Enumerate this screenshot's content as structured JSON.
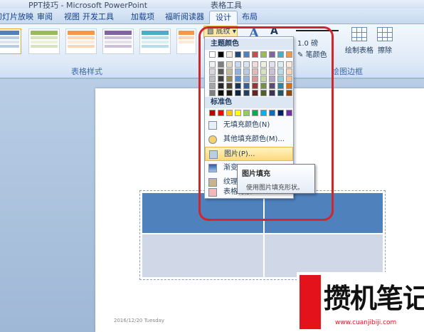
{
  "window": {
    "title": "PPT技巧 - Microsoft PowerPoint",
    "context_tab_group": "表格工具"
  },
  "ribbon_tabs": [
    {
      "label": "幻灯片放映"
    },
    {
      "label": "审阅"
    },
    {
      "label": "视图"
    },
    {
      "label": "开发工具"
    },
    {
      "label": "加载项"
    },
    {
      "label": "福昕阅读器"
    },
    {
      "label": "设计"
    },
    {
      "label": "布局"
    }
  ],
  "active_tab": "设计",
  "ribbon": {
    "table_styles_group": "表格样式",
    "shading_button": "底纹",
    "pen_weight": "1.0 磅",
    "pen_color": "笔颜色",
    "draw_table": "绘制表格",
    "eraser": "擦除",
    "draw_borders_group": "绘图边框"
  },
  "shading_menu": {
    "theme_colors_header": "主题颜色",
    "standard_colors_header": "标准色",
    "theme_top_row": [
      "#ffffff",
      "#000000",
      "#eeece1",
      "#1f497d",
      "#4f81bd",
      "#c0504d",
      "#9bbb59",
      "#8064a2",
      "#4bacc6",
      "#f79646"
    ],
    "theme_tints": [
      [
        "#f2f2f2",
        "#7f7f7f",
        "#ddd9c3",
        "#c6d9f0",
        "#dbe5f1",
        "#f2dcdb",
        "#ebf1dd",
        "#e5e0ec",
        "#dbeef3",
        "#fdeada"
      ],
      [
        "#d8d8d8",
        "#595959",
        "#c4bd97",
        "#8db3e2",
        "#b8cce4",
        "#e5b9b7",
        "#d7e3bc",
        "#ccc1d9",
        "#b7dde8",
        "#fbd5b5"
      ],
      [
        "#bfbfbf",
        "#3f3f3f",
        "#938953",
        "#548dd4",
        "#95b3d7",
        "#d99694",
        "#c3d69b",
        "#b2a2c7",
        "#92cddc",
        "#fac08f"
      ],
      [
        "#a5a5a5",
        "#262626",
        "#494429",
        "#17365d",
        "#366092",
        "#953734",
        "#76923c",
        "#5f497a",
        "#31859b",
        "#e36c09"
      ],
      [
        "#7f7f7f",
        "#0c0c0c",
        "#1d1b10",
        "#0f243e",
        "#244061",
        "#632423",
        "#4f6128",
        "#3f3151",
        "#205867",
        "#974806"
      ]
    ],
    "standard_colors": [
      "#c00000",
      "#ff0000",
      "#ffc000",
      "#ffff00",
      "#92d050",
      "#00b050",
      "#00b0f0",
      "#0070c0",
      "#002060",
      "#7030a0"
    ],
    "items": [
      {
        "label": "无填充颜色(N)"
      },
      {
        "label": "其他填充颜色(M)..."
      },
      {
        "label": "图片(P)..."
      },
      {
        "label": "渐变(G)"
      },
      {
        "label": "纹理(T)"
      },
      {
        "label": "表格背景"
      }
    ]
  },
  "tooltip": {
    "title": "图片填充",
    "description": "使用图片填充形状。"
  },
  "slide": {
    "date_text": "2016/12/20 Tuesday"
  },
  "watermark": {
    "brand": "攒机笔记",
    "url": "www.cuanjibiji.com"
  }
}
